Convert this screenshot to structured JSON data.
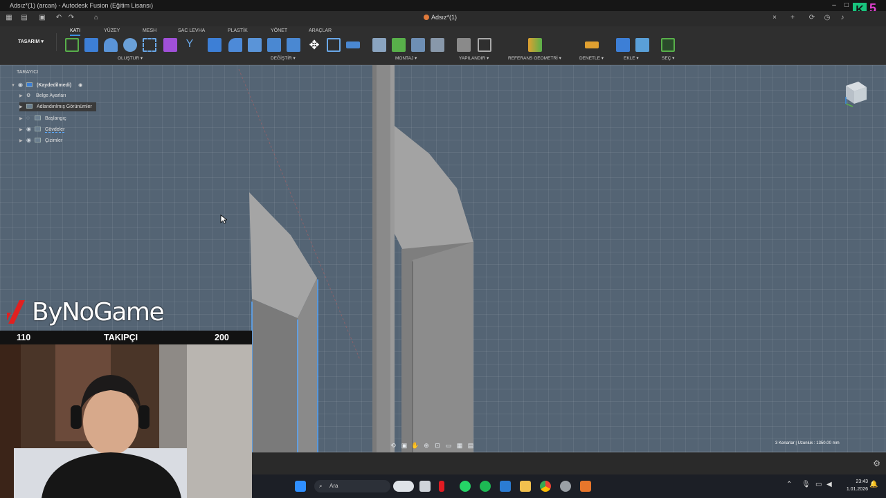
{
  "window": {
    "title": "Adsız*(1) (arcan) - Autodesk Fusion (Eğitim Lisansı)",
    "doc_tab": "Adsız*(1)"
  },
  "toolbar": {
    "workspace": "TASARIM",
    "tabs": [
      "KATI",
      "YÜZEY",
      "MESH",
      "SAC LEVHA",
      "PLASTİK",
      "YÖNET",
      "ARAÇLAR"
    ],
    "active_tab": "KATI",
    "groups": [
      "OLUŞTUR",
      "DEĞİŞTİR",
      "MONTAJ",
      "YAPILANDIR",
      "REFERANS GEOMETRİ",
      "DENETLE",
      "EKLE",
      "SEÇ"
    ]
  },
  "browser": {
    "header": "TARAYICI",
    "root": "(Kaydedilmedi)",
    "items": [
      "Belge Ayarları",
      "Adlandırılmış Görünümler",
      "Başlangıç",
      "Gövdeler",
      "Çizimler"
    ]
  },
  "status": {
    "selection": "3 Kenarlar | Uzunluk : 1350.00 mm"
  },
  "taskbar": {
    "search_placeholder": "Ara",
    "time": "23:43",
    "date": "1.01.2026"
  },
  "overlay": {
    "brand": "ByNoGame",
    "follower_current": "110",
    "follower_label": "TAKIPÇI",
    "follower_goal": "200",
    "k_badge": "K",
    "k_number": "5"
  },
  "colors": {
    "accent": "#3b8fe0",
    "viewport_bg": "#546474",
    "body_face": "#9a9a9a",
    "selected_edge": "#5aa9ff"
  }
}
